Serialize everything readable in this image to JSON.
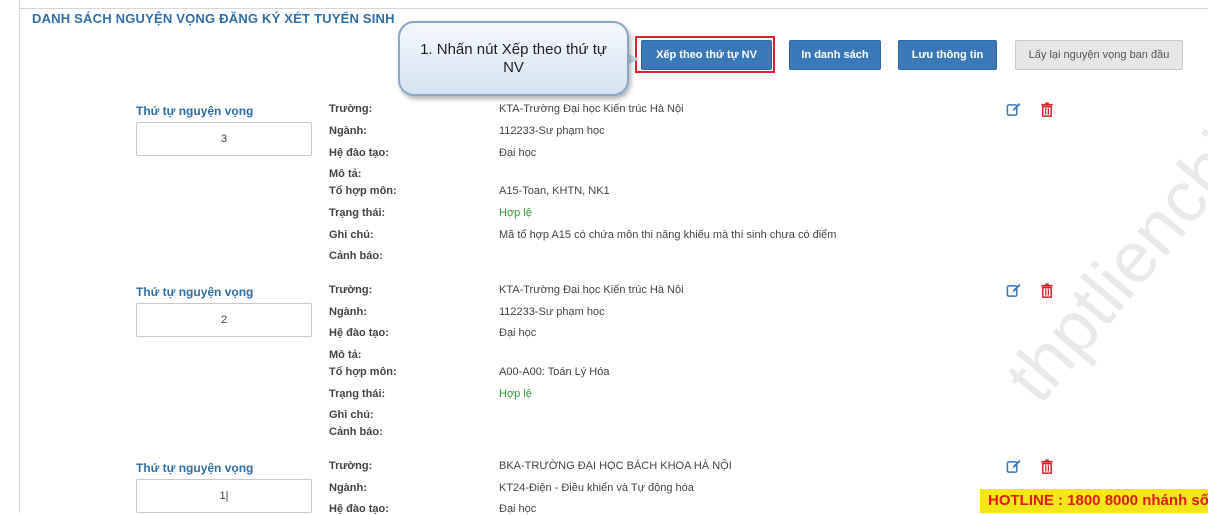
{
  "page_title": "DANH SÁCH NGUYỆN VỌNG ĐĂNG KÝ XÉT TUYỂN SINH",
  "toolbar": {
    "sort_label": "Xếp theo thứ tự NV",
    "print_label": "In danh sách",
    "save_label": "Lưu thông tin",
    "restore_label": "Lấy lại nguyện vọng ban đầu"
  },
  "callout": {
    "text": "1. Nhấn nút Xếp theo thứ tự NV"
  },
  "labels": {
    "order": "Thứ tự nguyện vọng",
    "school": "Trường:",
    "major": "Ngành:",
    "program": "Hệ đào tạo:",
    "description": "Mô tả:",
    "subjects": "Tổ hợp môn:",
    "status": "Trạng thái:",
    "note": "Ghi chú:",
    "warning": "Cảnh báo:"
  },
  "records": [
    {
      "order": "3",
      "school": "KTA-Trường Đại học Kiến trúc Hà Nội",
      "major": "112233-Sư phạm học",
      "program": "Đại học",
      "description": "",
      "subjects": "A15-Toan, KHTN, NK1",
      "status": "Hợp lệ",
      "note": "Mã tổ hợp A15 có chứa môn thi năng khiếu mà thí sinh chưa có điểm",
      "warning": ""
    },
    {
      "order": "2",
      "school": "KTA-Trường Đại học Kiến trúc Hà Nội",
      "major": "112233-Sư phạm học",
      "program": "Đại học",
      "description": "",
      "subjects": "A00-A00: Toán Lý Hóa",
      "status": "Hợp lệ",
      "note": "",
      "warning": ""
    },
    {
      "order": "1|",
      "school": "BKA-TRƯỜNG ĐẠI HỌC BÁCH KHOA HÀ NỘI",
      "major": "KT24-Điện - Điều khiển và Tự động hóa",
      "program": "Đại học"
    }
  ],
  "hotline": "HOTLINE : 1800 8000 nhánh số",
  "watermark": "thptlienchi",
  "colors": {
    "primary": "#3a78b7",
    "title": "#2d6fa8",
    "valid": "#2e9a36",
    "delete": "#d9242b",
    "hotline_bg": "#f7e51c"
  },
  "icons": {
    "edit": "edit-icon",
    "delete": "trash-icon"
  }
}
